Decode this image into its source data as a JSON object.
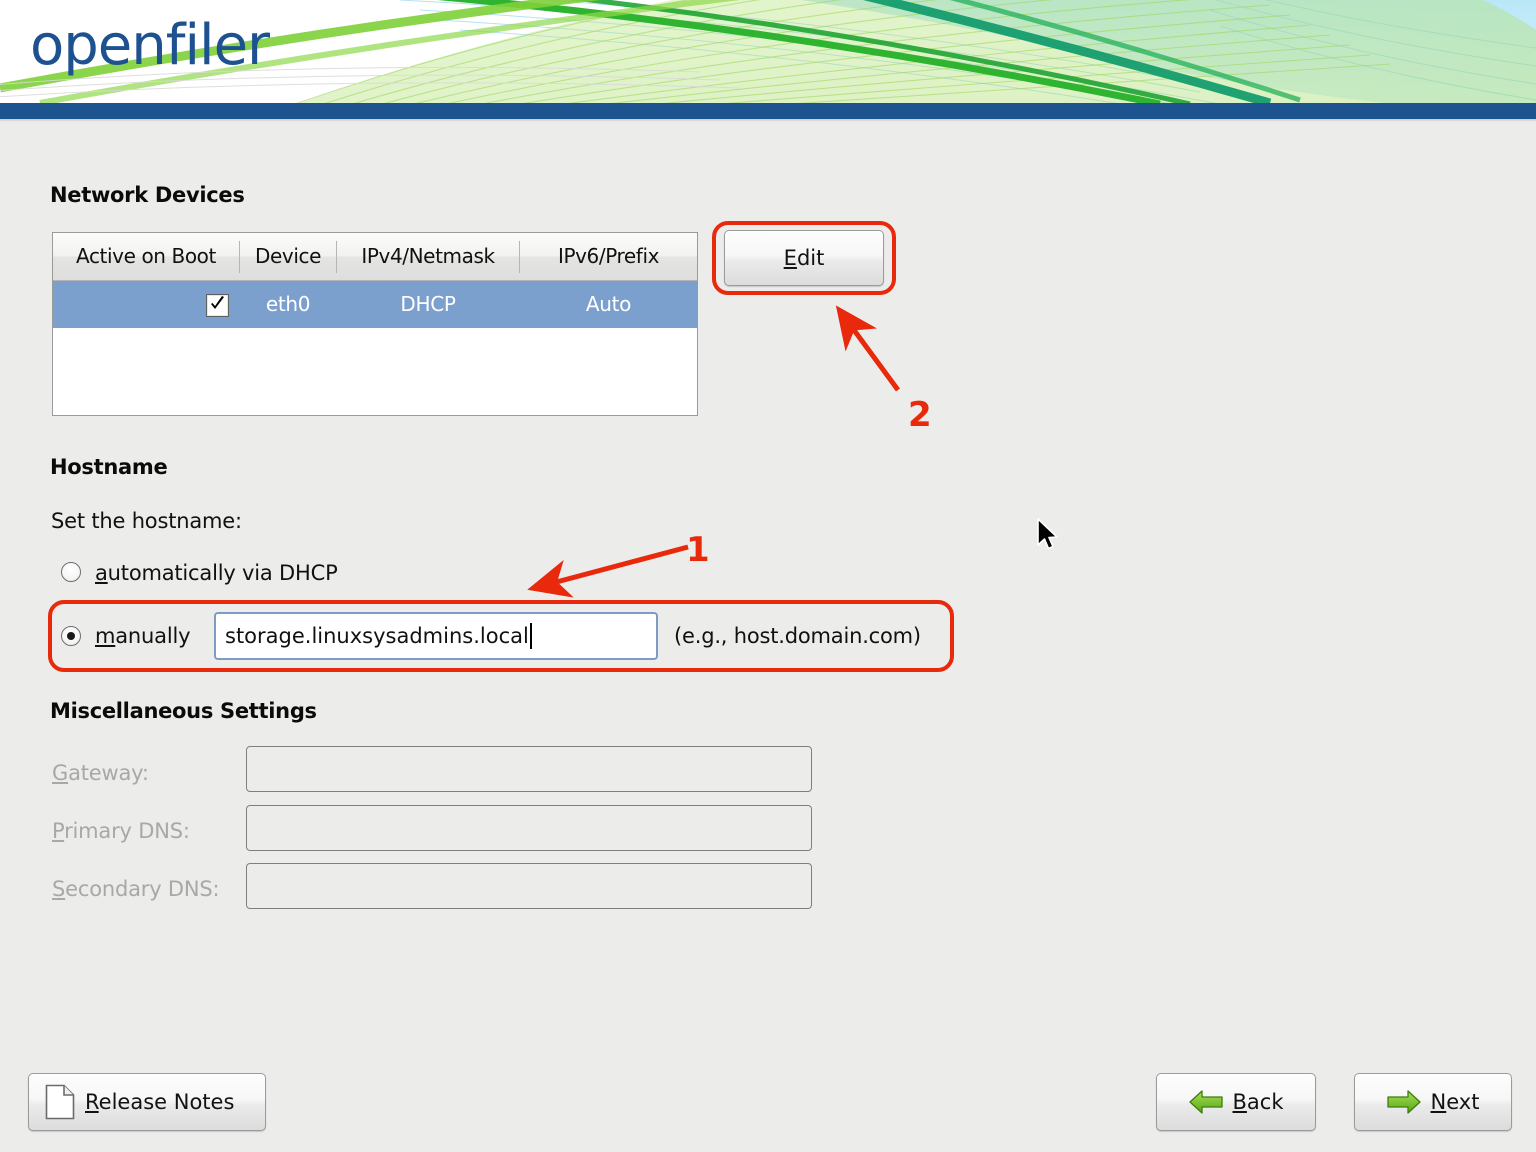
{
  "app": {
    "brand": "openfiler",
    "brand_color": "#1e5190",
    "header_bar_color": "#1d5490",
    "background_color": "#ececea",
    "accent_annotation_color": "#e8290b",
    "selection_color": "#7ba0ce"
  },
  "network_devices": {
    "title": "Network Devices",
    "columns": [
      "Active on Boot",
      "Device",
      "IPv4/Netmask",
      "IPv6/Prefix"
    ],
    "rows": [
      {
        "active_on_boot": true,
        "device": "eth0",
        "ipv4_netmask": "DHCP",
        "ipv6_prefix": "Auto",
        "selected": true
      }
    ],
    "edit_button": {
      "label": "Edit",
      "accel": "E",
      "label_rest": "dit"
    }
  },
  "hostname": {
    "title": "Hostname",
    "prompt": "Set the hostname:",
    "options": [
      {
        "id": "dhcp",
        "accel": "a",
        "label_rest": "utomatically via DHCP",
        "full_label": "automatically via DHCP",
        "selected": false
      },
      {
        "id": "manual",
        "accel": "m",
        "label_rest": "anually",
        "full_label": "manually",
        "selected": true
      }
    ],
    "input_value": "storage.linuxsysadmins.local",
    "example_hint": "(e.g.,  host.domain.com)"
  },
  "misc_settings": {
    "title": "Miscellaneous Settings",
    "fields": [
      {
        "accel": "G",
        "label_rest": "ateway:",
        "full_label": "Gateway:",
        "value": "",
        "disabled": true
      },
      {
        "accel": "P",
        "label_rest": "rimary DNS:",
        "full_label": "Primary DNS:",
        "value": "",
        "disabled": true
      },
      {
        "accel": "S",
        "label_rest": "econdary DNS:",
        "full_label": "Secondary DNS:",
        "value": "",
        "disabled": true
      }
    ]
  },
  "footer": {
    "release_notes": {
      "accel": "R",
      "label_rest": "elease Notes",
      "full_label": "Release Notes"
    },
    "back": {
      "accel": "B",
      "label_rest": "ack",
      "full_label": "Back"
    },
    "next": {
      "accel": "N",
      "label_rest": "ext",
      "full_label": "Next"
    }
  },
  "annotations": [
    {
      "id": "1",
      "label": "1",
      "target": "manually-hostname-row"
    },
    {
      "id": "2",
      "label": "2",
      "target": "edit-button"
    }
  ]
}
